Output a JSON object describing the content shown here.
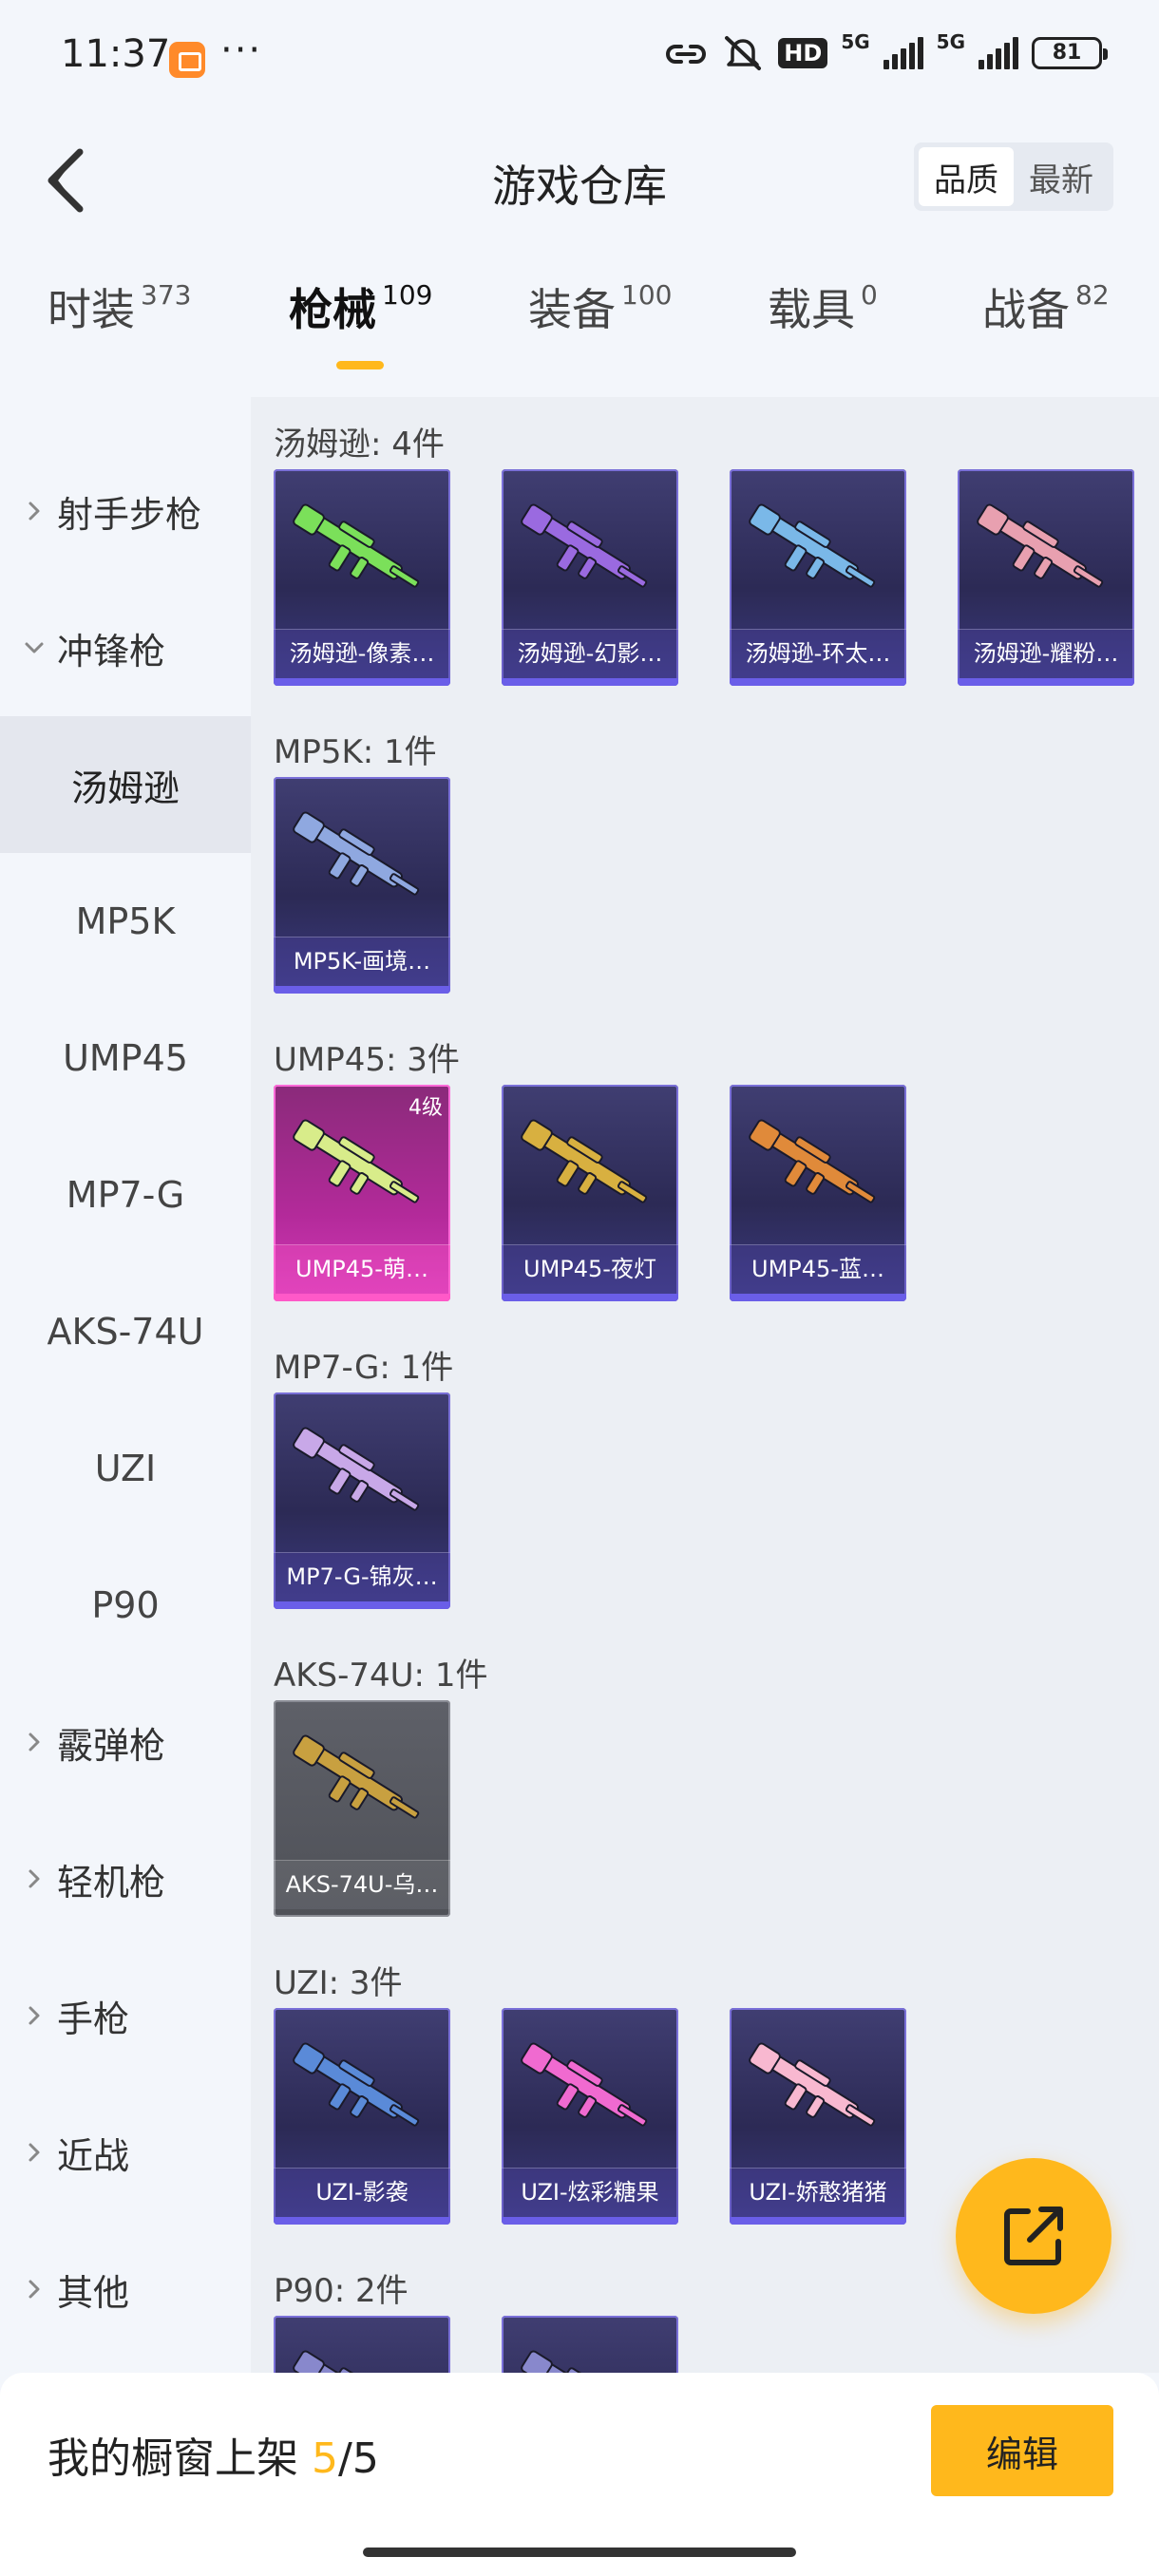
{
  "status": {
    "time": "11:37",
    "dots": "···",
    "hd": "HD",
    "sig1": "5G",
    "sig2": "5G",
    "battery": "81"
  },
  "header": {
    "title": "游戏仓库",
    "sort_quality": "品质",
    "sort_latest": "最新"
  },
  "tabs": [
    {
      "label": "时装",
      "count": "373"
    },
    {
      "label": "枪械",
      "count": "109"
    },
    {
      "label": "装备",
      "count": "100"
    },
    {
      "label": "载具",
      "count": "0"
    },
    {
      "label": "战备",
      "count": "82"
    }
  ],
  "sidebar": {
    "items": [
      {
        "label": "射手步枪",
        "kind": "group",
        "expanded": false
      },
      {
        "label": "冲锋枪",
        "kind": "group",
        "expanded": true
      },
      {
        "label": "汤姆逊",
        "kind": "sub",
        "selected": true
      },
      {
        "label": "MP5K",
        "kind": "sub"
      },
      {
        "label": "UMP45",
        "kind": "sub"
      },
      {
        "label": "MP7-G",
        "kind": "sub"
      },
      {
        "label": "AKS-74U",
        "kind": "sub"
      },
      {
        "label": "UZI",
        "kind": "sub"
      },
      {
        "label": "P90",
        "kind": "sub"
      },
      {
        "label": "霰弹枪",
        "kind": "group",
        "expanded": false
      },
      {
        "label": "轻机枪",
        "kind": "group",
        "expanded": false
      },
      {
        "label": "手枪",
        "kind": "group",
        "expanded": false
      },
      {
        "label": "近战",
        "kind": "group",
        "expanded": false
      },
      {
        "label": "其他",
        "kind": "group",
        "expanded": false
      }
    ]
  },
  "sections": [
    {
      "title": "汤姆逊: 4件",
      "items": [
        {
          "name": "汤姆逊-像素…",
          "color": "#7be05a",
          "tier": "purple"
        },
        {
          "name": "汤姆逊-幻影…",
          "color": "#9a6ae0",
          "tier": "purple"
        },
        {
          "name": "汤姆逊-环太…",
          "color": "#7ab8e8",
          "tier": "purple"
        },
        {
          "name": "汤姆逊-耀粉…",
          "color": "#e8a0b0",
          "tier": "purple"
        }
      ]
    },
    {
      "title": "MP5K: 1件",
      "items": [
        {
          "name": "MP5K-画境…",
          "color": "#8fa8e0",
          "tier": "purple"
        }
      ]
    },
    {
      "title": "UMP45: 3件",
      "items": [
        {
          "name": "UMP45-萌…",
          "color": "#d8ec8a",
          "tier": "pink",
          "badge": "4级"
        },
        {
          "name": "UMP45-夜灯",
          "color": "#d8b040",
          "tier": "purple"
        },
        {
          "name": "UMP45-蓝…",
          "color": "#e08a3a",
          "tier": "purple"
        }
      ]
    },
    {
      "title": "MP7-G: 1件",
      "items": [
        {
          "name": "MP7-G-锦灰…",
          "color": "#c8a8e8",
          "tier": "purple"
        }
      ]
    },
    {
      "title": "AKS-74U: 1件",
      "items": [
        {
          "name": "AKS-74U-乌…",
          "color": "#c8a040",
          "tier": "gray"
        }
      ]
    },
    {
      "title": "UZI: 3件",
      "items": [
        {
          "name": "UZI-影袭",
          "color": "#5a8ad8",
          "tier": "purple"
        },
        {
          "name": "UZI-炫彩糖果",
          "color": "#f06ad0",
          "tier": "purple"
        },
        {
          "name": "UZI-娇憨猪猪",
          "color": "#f8b8d0",
          "tier": "purple"
        }
      ]
    },
    {
      "title": "P90: 2件",
      "items": [
        {
          "name": "",
          "color": "#8888cc",
          "tier": "purple"
        },
        {
          "name": "",
          "color": "#8888cc",
          "tier": "purple"
        }
      ]
    }
  ],
  "bottom": {
    "shelf_label": "我的橱窗上架",
    "shelf_count": "5",
    "shelf_total": "/5",
    "edit_label": "编辑"
  }
}
